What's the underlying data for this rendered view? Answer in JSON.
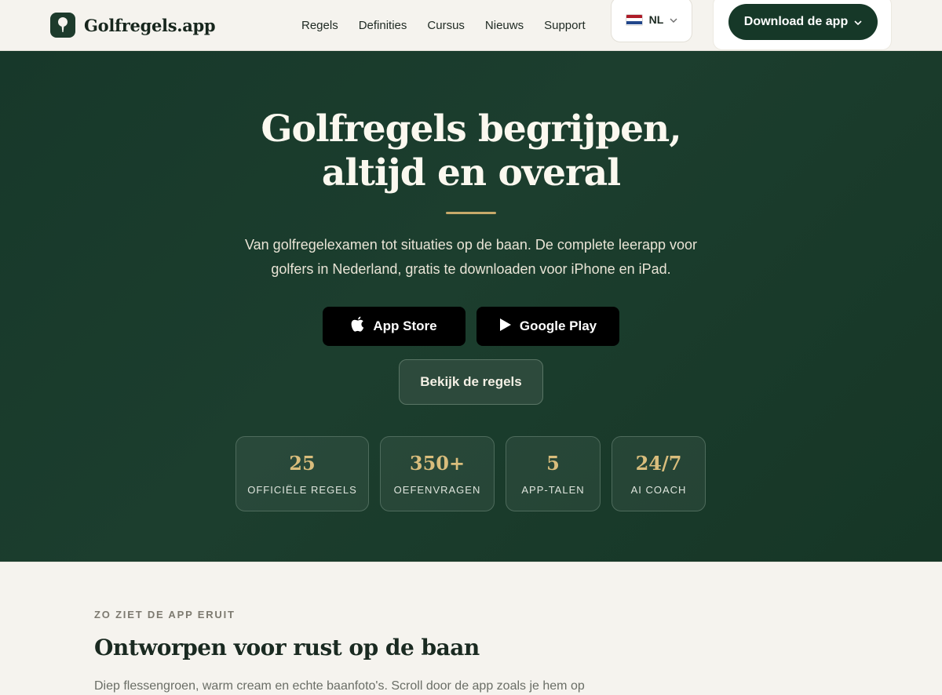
{
  "header": {
    "brand": "Golfregels.app",
    "nav": [
      "Regels",
      "Definities",
      "Cursus",
      "Nieuws",
      "Support"
    ],
    "language": "NL",
    "cta": "Download de app"
  },
  "hero": {
    "title_line1": "Golfregels begrijpen,",
    "title_line2": "altijd en overal",
    "subtitle_line1": "Van golfregelexamen tot situaties op de baan. De complete leerapp voor",
    "subtitle_line2": "golfers in Nederland, gratis te downloaden voor iPhone en iPad.",
    "app_store": "App Store",
    "google_play": "Google Play",
    "rules_button": "Bekijk de regels",
    "stats": [
      {
        "value": "25",
        "label": "OFFICIËLE REGELS"
      },
      {
        "value": "350+",
        "label": "OEFENVRAGEN"
      },
      {
        "value": "5",
        "label": "APP-TALEN"
      },
      {
        "value": "24/7",
        "label": "AI COACH"
      }
    ]
  },
  "preview": {
    "eyebrow": "ZO ZIET DE APP ERUIT",
    "title": "Ontworpen voor rust op de baan",
    "description": "Diep flessengroen, warm cream en echte baanfoto's. Scroll door de app zoals je hem op"
  },
  "colors": {
    "forest": "#163828",
    "gold": "#c7a96a",
    "cream": "#f5f3ee"
  }
}
